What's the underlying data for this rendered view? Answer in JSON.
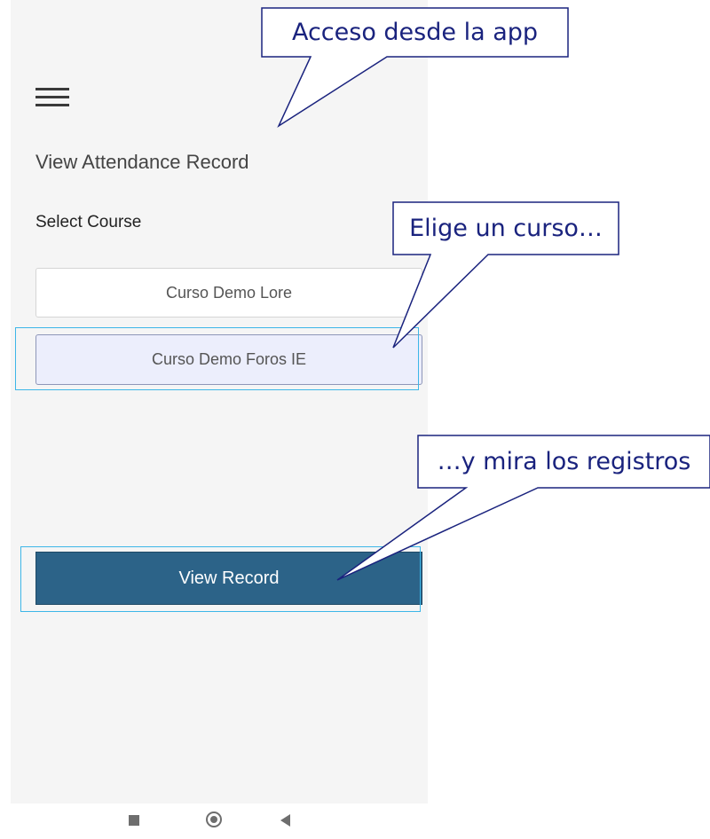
{
  "app": {
    "page_title": "View Attendance Record",
    "select_label": "Select Course",
    "menu_icon": "hamburger-menu-icon",
    "courses": [
      {
        "label": "Curso Demo Lore",
        "selected": false
      },
      {
        "label": "Curso Demo Foros IE",
        "selected": true
      }
    ],
    "view_button_label": "View Record"
  },
  "annotations": {
    "callout_1": "Acceso desde la app",
    "callout_2": "Elige un curso…",
    "callout_3": "…y mira los registros"
  },
  "navbar": {
    "icons": [
      "recents-square-icon",
      "home-circle-icon",
      "back-triangle-icon"
    ]
  },
  "colors": {
    "primary_button": "#2c6388",
    "selected_course_bg": "#eceefc",
    "highlight_border": "#3db6e8",
    "callout_text": "#1a237e",
    "callout_border": "#1a237e",
    "screen_bg": "#f5f5f5"
  }
}
